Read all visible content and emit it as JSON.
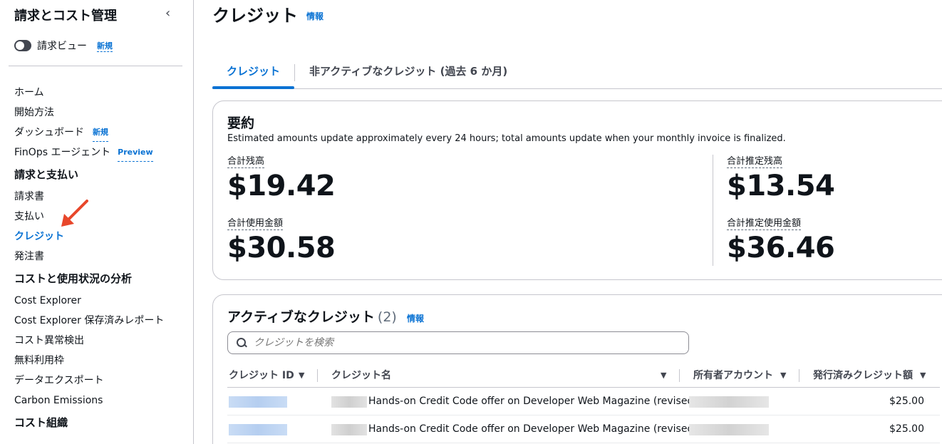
{
  "sidebar": {
    "title": "請求とコスト管理",
    "collapse_icon": "chevron-left-icon",
    "billing_view": {
      "label": "請求ビュー",
      "badge": "新規",
      "toggle_state": "off"
    },
    "items": [
      {
        "label": "ホーム"
      },
      {
        "label": "開始方法"
      },
      {
        "label": "ダッシュボード",
        "badge": "新規"
      },
      {
        "label": "FinOps エージェント",
        "badge": "Preview"
      }
    ],
    "sections": [
      {
        "title": "請求と支払い",
        "items": [
          "請求書",
          "支払い",
          "クレジット",
          "発注書"
        ]
      },
      {
        "title": "コストと使用状況の分析",
        "items": [
          "Cost Explorer",
          "Cost Explorer 保存済みレポート",
          "コスト異常検出",
          "無料利用枠",
          "データエクスポート",
          "Carbon Emissions"
        ]
      },
      {
        "title": "コスト組織",
        "items": []
      }
    ],
    "active_item": "クレジット",
    "accent_color": "#0972d3",
    "arrow_color": "#e8472b"
  },
  "main": {
    "title": "クレジット",
    "info": "情報",
    "tabs": [
      {
        "label": "クレジット",
        "active": true
      },
      {
        "label": "非アクティブなクレジット (過去 6 か月)",
        "active": false
      }
    ],
    "summary": {
      "title": "要約",
      "description": "Estimated amounts update approximately every 24 hours; total amounts update when your monthly invoice is finalized.",
      "total_balance_label": "合計残高",
      "total_balance": "$19.42",
      "total_usage_label": "合計使用金額",
      "total_usage": "$30.58",
      "est_balance_label": "合計推定残高",
      "est_balance": "$13.54",
      "est_usage_label": "合計推定使用金額",
      "est_usage": "$36.46"
    },
    "active_credits": {
      "title": "アクティブなクレジット",
      "count": "(2)",
      "info": "情報",
      "search_placeholder": "クレジットを検索",
      "columns": [
        "クレジット ID",
        "クレジット名",
        "所有者アカウント",
        "発行済みクレジット額"
      ],
      "rows": [
        {
          "name": "Hands-on Credit Code offer on Developer Web Magazine (revised)",
          "amount": "$25.00"
        },
        {
          "name": "Hands-on Credit Code offer on Developer Web Magazine (revised)",
          "amount": "$25.00"
        }
      ]
    }
  }
}
